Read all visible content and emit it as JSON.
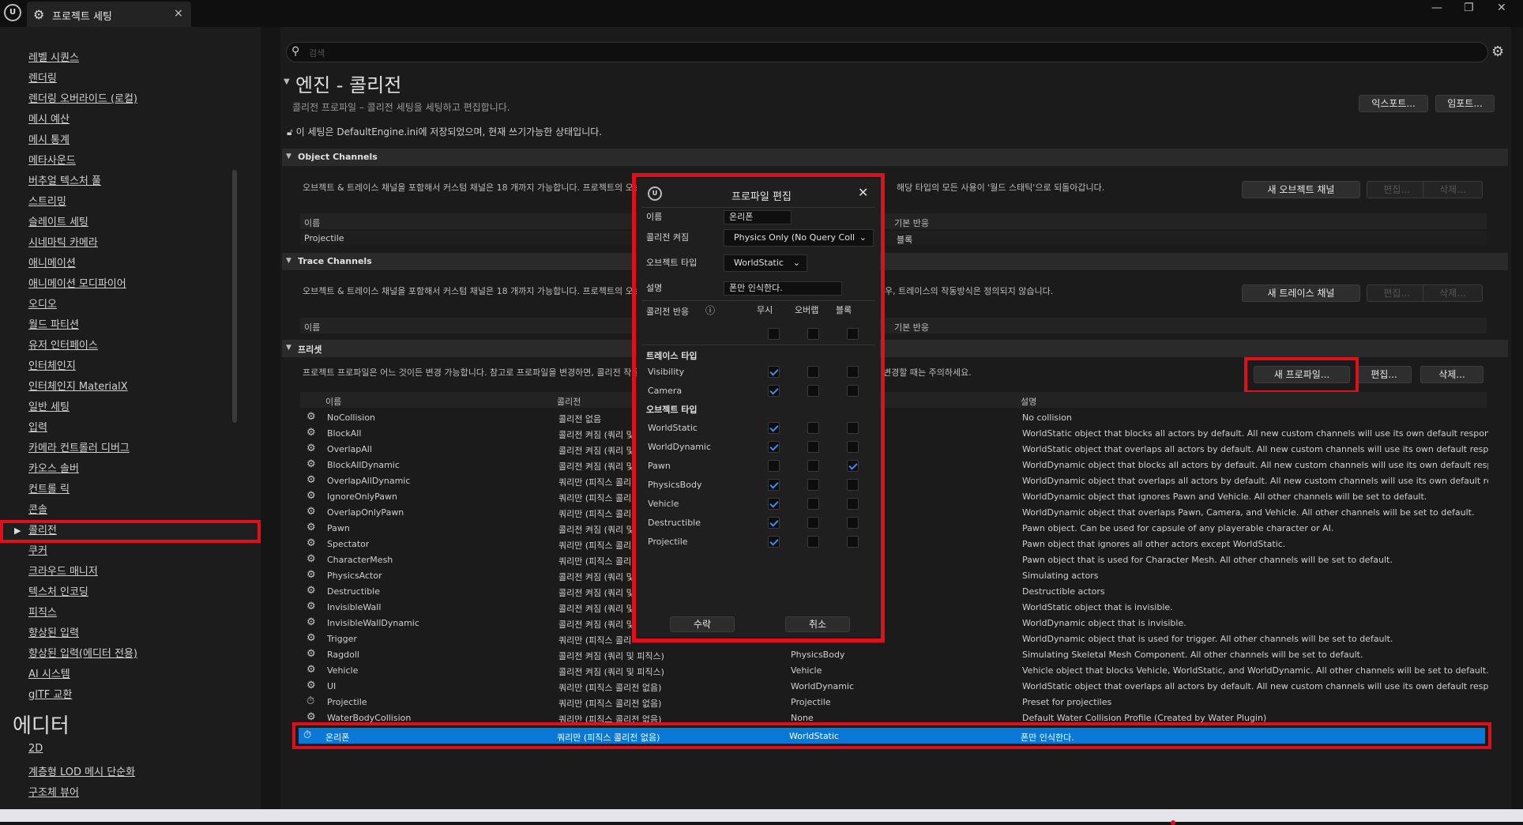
{
  "window": {
    "tab_title": "프로젝트 세팅",
    "close": "×",
    "controls": [
      "—",
      "❐",
      "✕"
    ]
  },
  "sidebar": {
    "items": [
      "레벨 시퀀스",
      "렌더링",
      "렌더링 오버라이드 (로컬)",
      "메시 예산",
      "메시 통계",
      "메타사운드",
      "버추얼 텍스처 풀",
      "스트리밍",
      "슬레이트 세팅",
      "시네마틱 카메라",
      "애니메이션",
      "애니메이션 모디파이어",
      "오디오",
      "월드 파티션",
      "유저 인터페이스",
      "인터체인지",
      "인터체인지 MaterialX",
      "일반 세팅",
      "입력",
      "카메라 컨트롤러 디버그",
      "카오스 솔버",
      "컨트롤 릭",
      "콘솔",
      "콜리전",
      "쿠커",
      "크라우드 매니저",
      "텍스처 인코딩",
      "피직스",
      "향상된 입력",
      "향상된 입력(에디터 전용)",
      "AI 시스템",
      "glTF 교환"
    ],
    "selected": "콜리전",
    "editor_header": "에디터",
    "editor_items": [
      "2D",
      "계층형 LOD 메시 단순화",
      "구조체 뷰어"
    ]
  },
  "search": {
    "placeholder": "검색"
  },
  "page": {
    "title": "엔진 - 콜리전",
    "subtitle": "콜리전 프로파일 – 콜리전 세팅을 세팅하고 편집합니다.",
    "info": "이 세팅은 DefaultEngine.ini에 저장되었으며, 현재 쓰기가능한 상태입니다.",
    "export": "익스포트...",
    "import": "임포트..."
  },
  "object_channels": {
    "title": "Object Channels",
    "desc_left": "오브젝트 & 트레이스 채널을 포함해서 커스텀 채널은 18 개까지 가능합니다. 프로젝트의 오브",
    "desc_right": "해당 타입의 모든 사용이 '월드 스태틱'으로 되돌아갑니다.",
    "new": "새 오브젝트 채널",
    "edit": "편집...",
    "delete": "삭제...",
    "col_name": "이름",
    "col_default": "기본 반응",
    "row_name": "Projectile",
    "row_default": "블록"
  },
  "trace_channels": {
    "title": "Trace Channels",
    "desc_left": "오브젝트 & 트레이스 채널을 포함해서 커스텀 채널은 18 개까지 가능합니다. 프로젝트의 오브",
    "desc_right": "우, 트레이스의 작동방식은 정의되지 않습니다.",
    "new": "새 트레이스 채널",
    "edit": "편집...",
    "delete": "삭제...",
    "col_name": "이름",
    "col_default": "기본 반응"
  },
  "presets": {
    "title": "프리셋",
    "desc_left": "프로젝트 프로파일은 어느 것이든 변경 가능합니다. 참고로 프로파일을 변경하면, 콜리전 작동",
    "desc_right": "변경할 때는 주의하세요.",
    "new": "새 프로파일...",
    "edit": "편집...",
    "delete": "삭제...",
    "col_name": "이름",
    "col_collision": "콜리전",
    "col_desc": "설명",
    "rows": [
      {
        "name": "NoCollision",
        "collision": "콜리전 없음",
        "type": "",
        "desc": "No collision"
      },
      {
        "name": "BlockAll",
        "collision": "콜리전 켜짐 (쿼리 및",
        "type": "",
        "desc": "WorldStatic object that blocks all actors by default. All new custom channels will use its own default response."
      },
      {
        "name": "OverlapAll",
        "collision": "콜리전 켜짐 (쿼리 및",
        "type": "",
        "desc": "WorldStatic object that overlaps all actors by default. All new custom channels will use its own default response."
      },
      {
        "name": "BlockAllDynamic",
        "collision": "콜리전 켜짐 (쿼리 및",
        "type": "",
        "desc": "WorldDynamic object that blocks all actors by default. All new custom channels will use its own default response."
      },
      {
        "name": "OverlapAllDynamic",
        "collision": "쿼리만 (피직스 콜리",
        "type": "",
        "desc": "WorldDynamic object that overlaps all actors by default. All new custom channels will use its own default response."
      },
      {
        "name": "IgnoreOnlyPawn",
        "collision": "쿼리만 (피직스 콜리",
        "type": "",
        "desc": "WorldDynamic object that ignores Pawn and Vehicle. All other channels will be set to default."
      },
      {
        "name": "OverlapOnlyPawn",
        "collision": "쿼리만 (피직스 콜리",
        "type": "",
        "desc": "WorldDynamic object that overlaps Pawn, Camera, and Vehicle. All other channels will be set to default."
      },
      {
        "name": "Pawn",
        "collision": "콜리전 켜짐 (쿼리 및",
        "type": "",
        "desc": "Pawn object. Can be used for capsule of any playerable character or AI."
      },
      {
        "name": "Spectator",
        "collision": "쿼리만 (피직스 콜리",
        "type": "",
        "desc": "Pawn object that ignores all other actors except WorldStatic."
      },
      {
        "name": "CharacterMesh",
        "collision": "쿼리만 (피직스 콜리",
        "type": "",
        "desc": "Pawn object that is used for Character Mesh. All other channels will be set to default."
      },
      {
        "name": "PhysicsActor",
        "collision": "콜리전 켜짐 (쿼리 및",
        "type": "",
        "desc": "Simulating actors"
      },
      {
        "name": "Destructible",
        "collision": "콜리전 켜짐 (쿼리 및",
        "type": "",
        "desc": "Destructible actors"
      },
      {
        "name": "InvisibleWall",
        "collision": "콜리전 켜짐 (쿼리 및",
        "type": "",
        "desc": "WorldStatic object that is invisible."
      },
      {
        "name": "InvisibleWallDynamic",
        "collision": "콜리전 켜짐 (쿼리 및",
        "type": "",
        "desc": "WorldDynamic object that is invisible."
      },
      {
        "name": "Trigger",
        "collision": "쿼리만 (피직스 콜리",
        "type": "",
        "desc": "WorldDynamic object that is used for trigger. All other channels will be set to default."
      },
      {
        "name": "Ragdoll",
        "collision": "콜리전 켜짐 (쿼리 및 피직스)",
        "type": "PhysicsBody",
        "desc": "Simulating Skeletal Mesh Component. All other channels will be set to default."
      },
      {
        "name": "Vehicle",
        "collision": "콜리전 켜짐 (쿼리 및 피직스)",
        "type": "Vehicle",
        "desc": "Vehicle object that blocks Vehicle, WorldStatic, and WorldDynamic. All other channels will be set to default."
      },
      {
        "name": "UI",
        "collision": "쿼리만 (피직스 콜리전 없음)",
        "type": "WorldDynamic",
        "desc": "WorldStatic object that overlaps all actors by default. All new custom channels will use its own default response."
      },
      {
        "name": "Projectile",
        "collision": "쿼리만 (피직스 콜리전 없음)",
        "type": "Projectile",
        "desc": "Preset for projectiles"
      },
      {
        "name": "WaterBodyCollision",
        "collision": "쿼리만 (피직스 콜리전 없음)",
        "type": "None",
        "desc": "Default Water Collision Profile (Created by Water Plugin)"
      }
    ],
    "selected": {
      "name": "온리폰",
      "collision": "쿼리만 (피직스 콜리전 없음)",
      "type": "WorldStatic",
      "desc": "폰만 인식한다."
    }
  },
  "dialog": {
    "title": "프로파일 편집",
    "lbl_name": "이름",
    "name": "온리폰",
    "lbl_collision": "콜리전 켜짐",
    "collision": "Physics Only (No Query Coll",
    "lbl_objtype": "오브젝트 타입",
    "objtype": "WorldStatic",
    "lbl_desc": "설명",
    "desc": "폰만 인식한다.",
    "lbl_response": "콜리전 반응",
    "col_ignore": "무시",
    "col_overlap": "오버랩",
    "col_block": "블록",
    "sec_trace": "트레이스 타입",
    "sec_object": "오브젝트 타입",
    "trace_rows": [
      {
        "name": "Visibility",
        "state": "ignore"
      },
      {
        "name": "Camera",
        "state": "ignore"
      }
    ],
    "object_rows": [
      {
        "name": "WorldStatic",
        "state": "ignore"
      },
      {
        "name": "WorldDynamic",
        "state": "ignore"
      },
      {
        "name": "Pawn",
        "state": "block"
      },
      {
        "name": "PhysicsBody",
        "state": "ignore"
      },
      {
        "name": "Vehicle",
        "state": "ignore"
      },
      {
        "name": "Destructible",
        "state": "ignore"
      },
      {
        "name": "Projectile",
        "state": "ignore"
      }
    ],
    "accept": "수락",
    "cancel": "취소"
  }
}
